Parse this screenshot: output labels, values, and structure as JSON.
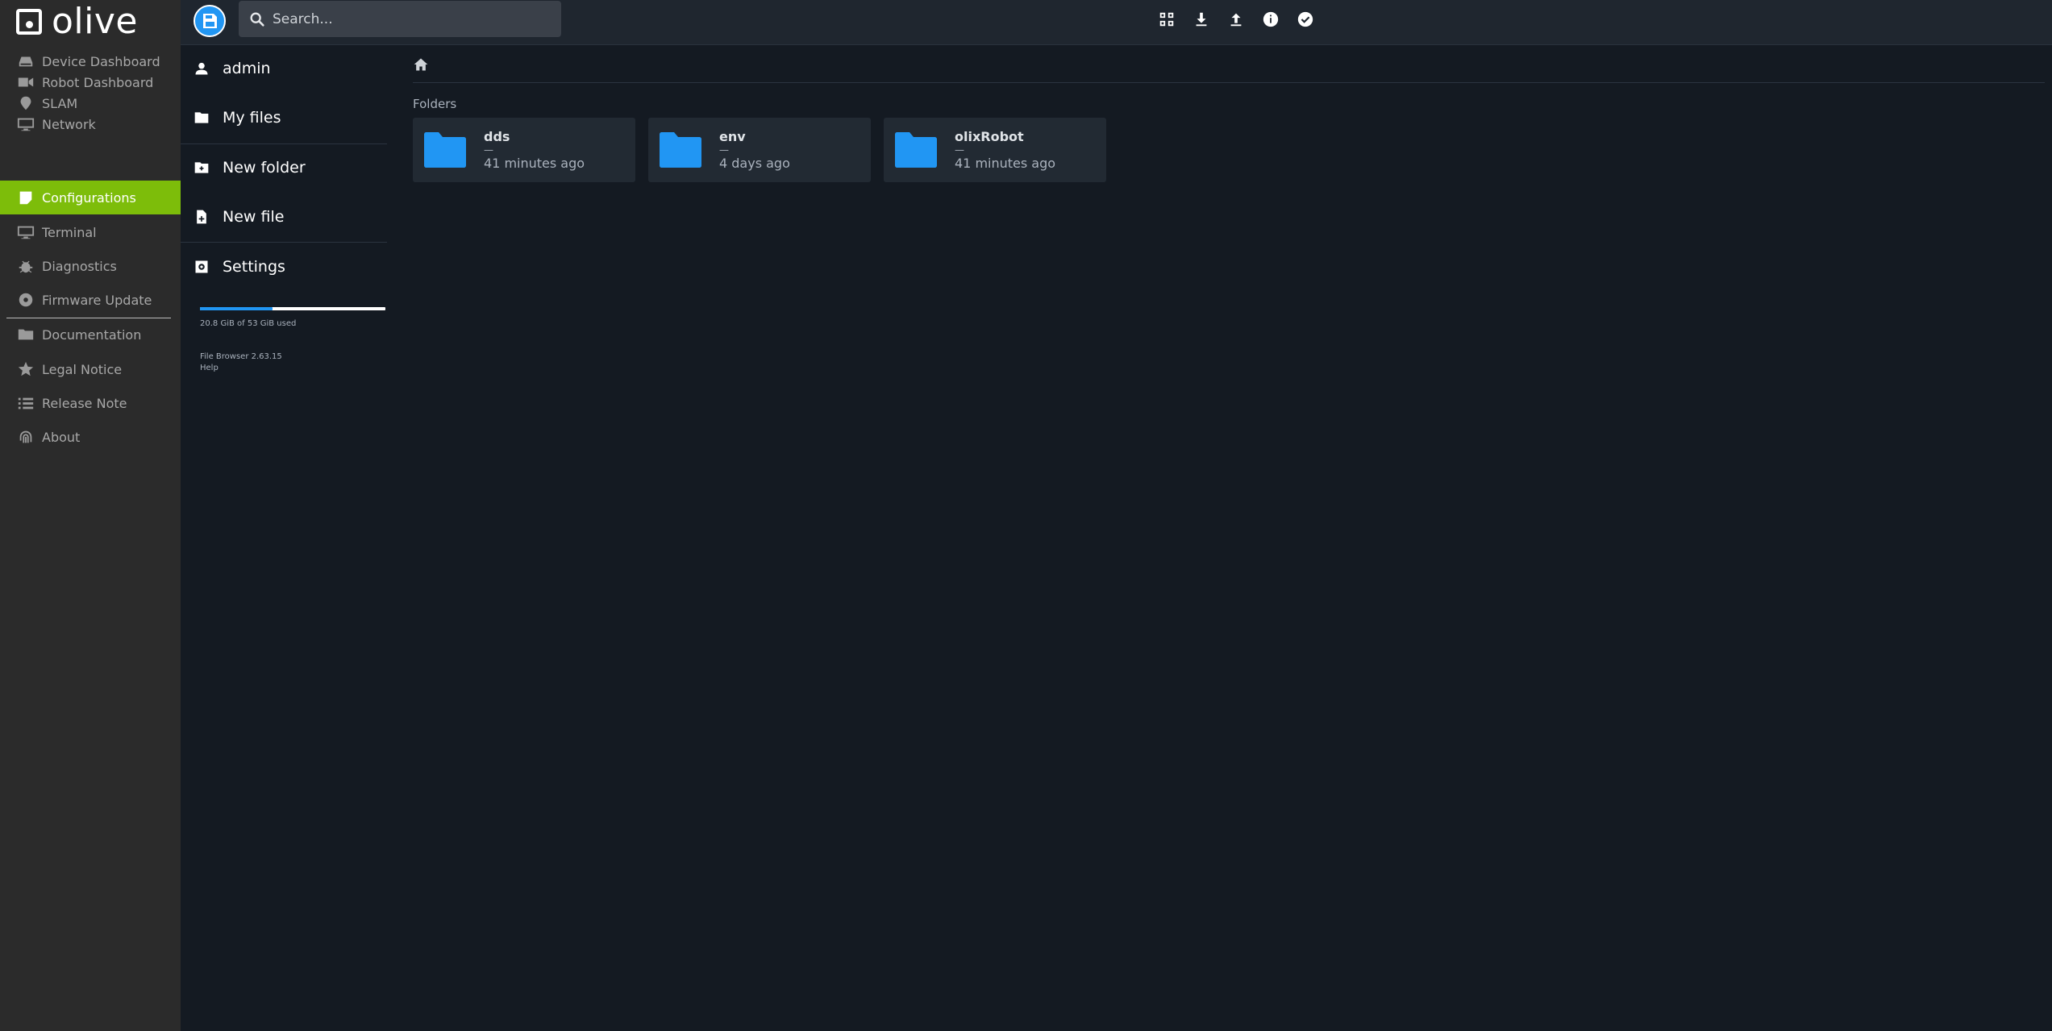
{
  "app_nav": {
    "brand": "olive",
    "items": [
      {
        "label": "Device Dashboard",
        "icon": "hdd-icon"
      },
      {
        "label": "Robot Dashboard",
        "icon": "video-camera-icon"
      },
      {
        "label": "SLAM",
        "icon": "map-pin-icon"
      },
      {
        "label": "Network",
        "icon": "monitor-icon"
      },
      {
        "label": "Configurations",
        "icon": "sticky-note-icon",
        "active": true
      },
      {
        "label": "Terminal",
        "icon": "monitor-icon"
      },
      {
        "label": "Diagnostics",
        "icon": "bug-icon"
      },
      {
        "label": "Firmware Update",
        "icon": "disc-icon"
      },
      {
        "label": "Documentation",
        "icon": "folder-icon"
      },
      {
        "label": "Legal Notice",
        "icon": "star-icon"
      },
      {
        "label": "Release Note",
        "icon": "list-icon"
      },
      {
        "label": "About",
        "icon": "fingerprint-icon"
      }
    ],
    "active_color": "#7dbd0a"
  },
  "topbar": {
    "search_placeholder": "Search...",
    "actions": [
      {
        "name": "grid-view-icon"
      },
      {
        "name": "download-icon"
      },
      {
        "name": "upload-icon"
      },
      {
        "name": "info-icon"
      },
      {
        "name": "select-all-icon"
      }
    ]
  },
  "sidebar": {
    "user": "admin",
    "my_files": "My files",
    "new_folder": "New folder",
    "new_file": "New file",
    "settings": "Settings",
    "usage_text": "20.8 GiB of 53 GiB used",
    "usage_fraction": 0.39,
    "version": "File Browser 2.63.15",
    "help": "Help"
  },
  "listing": {
    "section_label": "Folders",
    "folders": [
      {
        "name": "dds",
        "size": "—",
        "modified": "41 minutes ago"
      },
      {
        "name": "env",
        "size": "—",
        "modified": "4 days ago"
      },
      {
        "name": "olixRobot",
        "size": "—",
        "modified": "41 minutes ago"
      }
    ],
    "accent": "#2196f3"
  }
}
